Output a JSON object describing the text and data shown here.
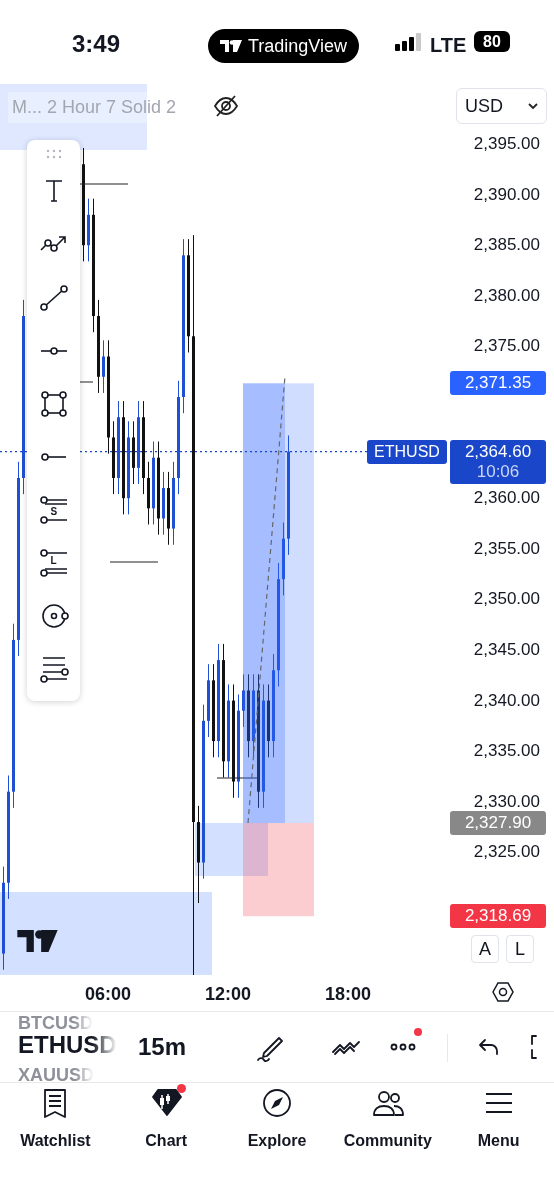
{
  "status_bar": {
    "time": "3:49",
    "app_pill": "TradingView",
    "network": "LTE",
    "battery": "80"
  },
  "chart": {
    "legend": "M... 2 Hour 7 Solid 2",
    "currency": "USD",
    "price_ticks": [
      "2,395.00",
      "2,390.00",
      "2,385.00",
      "2,380.00",
      "2,375.00",
      "2,360.00",
      "2,355.00",
      "2,350.00",
      "2,345.00",
      "2,340.00",
      "2,335.00",
      "2,330.00",
      "2,325.00"
    ],
    "price_badges": [
      {
        "kind": "target",
        "price": "2,371.35"
      },
      {
        "kind": "entry",
        "price": "2,327.90"
      },
      {
        "kind": "stop",
        "price": "2,318.69"
      }
    ],
    "last_price": {
      "symbol": "ETHUSD",
      "price": "2,364.60",
      "countdown": "10:06"
    },
    "axis_buttons": [
      "A",
      "L"
    ],
    "time_ticks": [
      "06:00",
      "12:00",
      "18:00"
    ]
  },
  "drawing_toolbar": {
    "tools": [
      {
        "kind": "text"
      },
      {
        "kind": "path"
      },
      {
        "kind": "trend"
      },
      {
        "kind": "hline"
      },
      {
        "kind": "rect"
      },
      {
        "kind": "ray"
      },
      {
        "kind": "short",
        "label": "S"
      },
      {
        "kind": "long",
        "label": "L"
      },
      {
        "kind": "circle"
      },
      {
        "kind": "fib"
      }
    ]
  },
  "symbol_bar": {
    "symbols": [
      {
        "label": "BTCUSD",
        "selected": false
      },
      {
        "label": "ETHUSD",
        "selected": true
      },
      {
        "label": "XAUUSD",
        "selected": false
      }
    ],
    "interval": "15m",
    "tools": [
      {
        "kind": "draw",
        "badge": false
      },
      {
        "kind": "patterns",
        "badge": false
      },
      {
        "kind": "more",
        "badge": true
      },
      {
        "kind": "undo",
        "badge": false
      },
      {
        "kind": "fullscreen",
        "badge": false
      }
    ]
  },
  "nav": {
    "tabs": [
      {
        "kind": "watchlist",
        "label": "Watchlist",
        "selected": false,
        "badge": false
      },
      {
        "kind": "chart",
        "label": "Chart",
        "selected": true,
        "badge": true
      },
      {
        "kind": "explore",
        "label": "Explore",
        "selected": false,
        "badge": false
      },
      {
        "kind": "community",
        "label": "Community",
        "selected": false,
        "badge": false
      },
      {
        "kind": "menu",
        "label": "Menu",
        "selected": false,
        "badge": false
      }
    ]
  }
}
